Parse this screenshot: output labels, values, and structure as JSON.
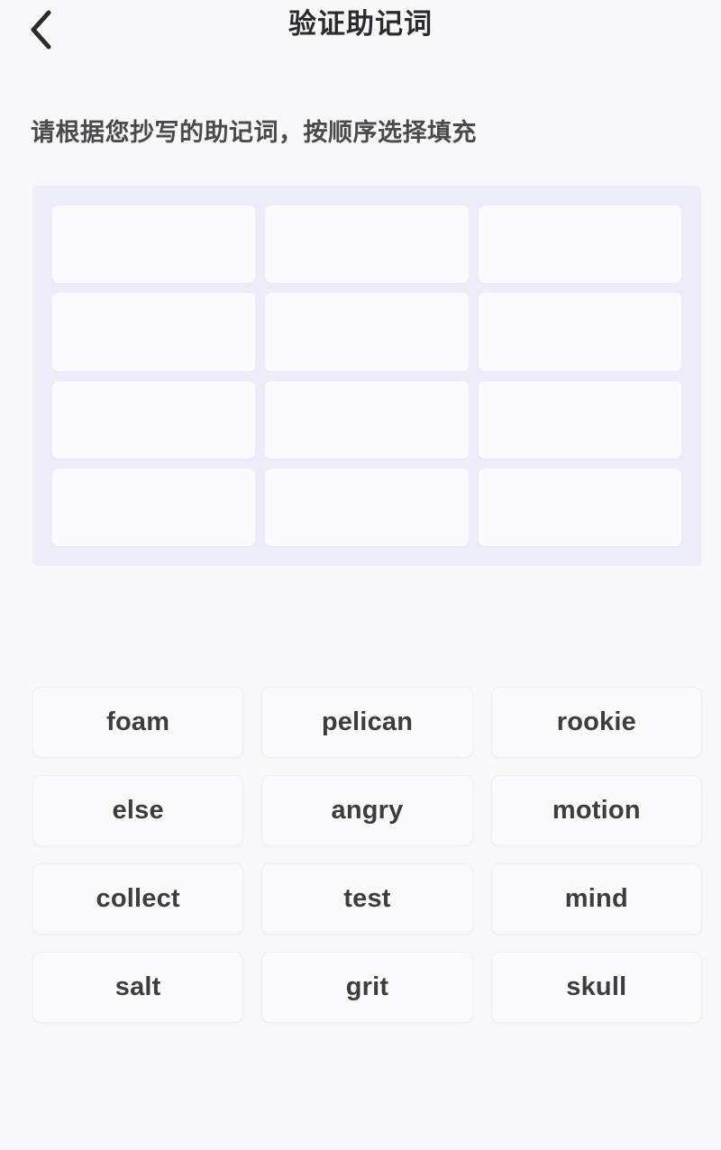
{
  "header": {
    "title": "验证助记词",
    "back_icon": "chevron-left-icon"
  },
  "instruction": "请根据您抄写的助记词，按顺序选择填充",
  "slots_panel": {
    "columns": 3,
    "rows": 4,
    "slots": [
      {
        "index": 1,
        "value": ""
      },
      {
        "index": 2,
        "value": ""
      },
      {
        "index": 3,
        "value": ""
      },
      {
        "index": 4,
        "value": ""
      },
      {
        "index": 5,
        "value": ""
      },
      {
        "index": 6,
        "value": ""
      },
      {
        "index": 7,
        "value": ""
      },
      {
        "index": 8,
        "value": ""
      },
      {
        "index": 9,
        "value": ""
      },
      {
        "index": 10,
        "value": ""
      },
      {
        "index": 11,
        "value": ""
      },
      {
        "index": 12,
        "value": ""
      }
    ]
  },
  "word_bank": {
    "columns": 3,
    "words": [
      "foam",
      "pelican",
      "rookie",
      "else",
      "angry",
      "motion",
      "collect",
      "test",
      "mind",
      "salt",
      "grit",
      "skull"
    ]
  },
  "colors": {
    "page_background": "#f8f8fb",
    "panel_background": "#ededfa",
    "slot_background": "#fbfbfe",
    "chip_background": "#fafafc",
    "chip_border": "#eeeef2",
    "title_text": "#2b2b2e",
    "body_text": "#4a4a4e",
    "chip_text": "#3d3d41"
  }
}
